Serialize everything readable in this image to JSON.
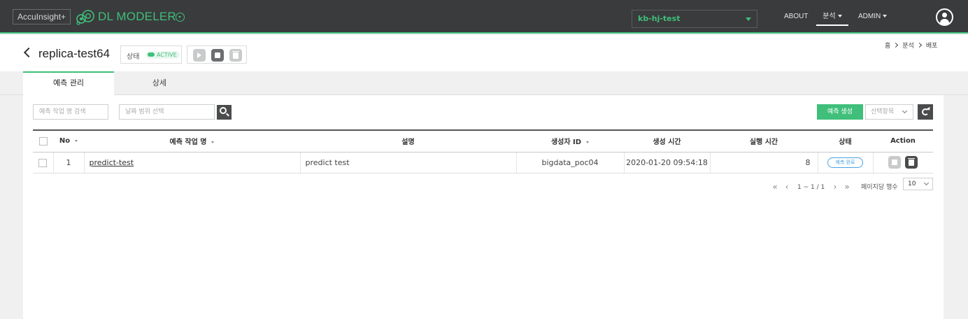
{
  "header": {
    "brand": "AccuInsight+",
    "app_title": "DL MODELER",
    "project": "kb-hj-test",
    "nav": {
      "about": "ABOUT",
      "analysis": "분석",
      "admin": "ADMIN"
    },
    "colors": {
      "accent": "#3fbf7a",
      "bar": "#3a3b3d"
    }
  },
  "titlebar": {
    "title": "replica-test64",
    "status_label": "상태",
    "status_value": "ACTIVE",
    "breadcrumb": [
      "홈",
      "분석",
      "배포"
    ]
  },
  "tabs": [
    {
      "label": "예측 관리",
      "active": true
    },
    {
      "label": "상세",
      "active": false
    }
  ],
  "filters": {
    "name_placeholder": "예측 작업 명 검색",
    "date_placeholder": "날짜 범위 선택",
    "create_label": "예측 생성",
    "select_placeholder": "선택항목"
  },
  "table": {
    "columns": [
      "No",
      "예측 작업 명",
      "설명",
      "생성자 ID",
      "생성 시간",
      "실행 시간",
      "상태",
      "Action"
    ],
    "rows": [
      {
        "no": "1",
        "name": "predict-test",
        "description": "predict test",
        "creator": "bigdata_poc04",
        "created": "2020-01-20 09:54:18",
        "runtime": "8",
        "status": "예측 완료"
      }
    ]
  },
  "pagination": {
    "range": "1 ~ 1 / 1",
    "rows_per_page_label": "페이지당 행수",
    "rows_per_page": "10"
  }
}
